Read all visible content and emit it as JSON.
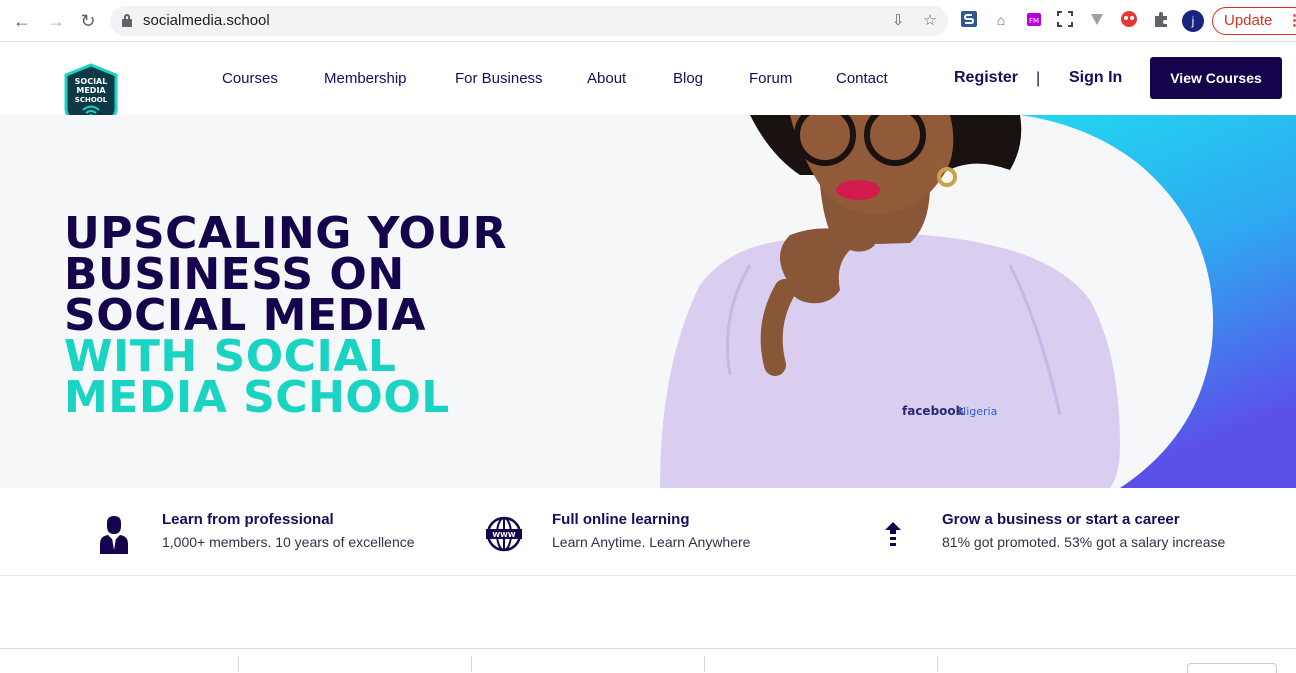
{
  "browser": {
    "url": "socialmedia.school",
    "update_label": "Update",
    "avatar_initial": "j"
  },
  "header": {
    "logo_text": [
      "SOCIAL",
      "MEDIA",
      "SCHOOL"
    ],
    "nav": [
      {
        "label": "Courses"
      },
      {
        "label": "Membership"
      },
      {
        "label": "For Business"
      },
      {
        "label": "About"
      },
      {
        "label": "Blog"
      },
      {
        "label": "Forum"
      },
      {
        "label": "Contact"
      }
    ],
    "register_label": "Register",
    "divider": "|",
    "signin_label": "Sign In",
    "cta_label": "View Courses"
  },
  "hero": {
    "title_dark": [
      "UPSCALING YOUR",
      "BUSINESS ON",
      "SOCIAL MEDIA"
    ],
    "title_teal": [
      "WITH SOCIAL",
      "MEDIA SCHOOL"
    ],
    "shirt_brand": "facebook",
    "shirt_brand_sub": "Nigeria"
  },
  "features": [
    {
      "title": "Learn from professional",
      "subtitle": "1,000+ members. 10 years of excellence",
      "icon": "person-icon"
    },
    {
      "title": "Full online learning",
      "subtitle": "Learn Anytime. Learn Anywhere",
      "icon": "globe-www-icon"
    },
    {
      "title": "Grow a business or start a career",
      "subtitle": "81% got promoted. 53% got a salary increase",
      "icon": "growth-arrow-icon"
    }
  ],
  "colors": {
    "brand_dark": "#15044c",
    "brand_teal": "#19d3c3",
    "gradient_start": "#22d8f0",
    "gradient_end": "#5b4fea"
  }
}
